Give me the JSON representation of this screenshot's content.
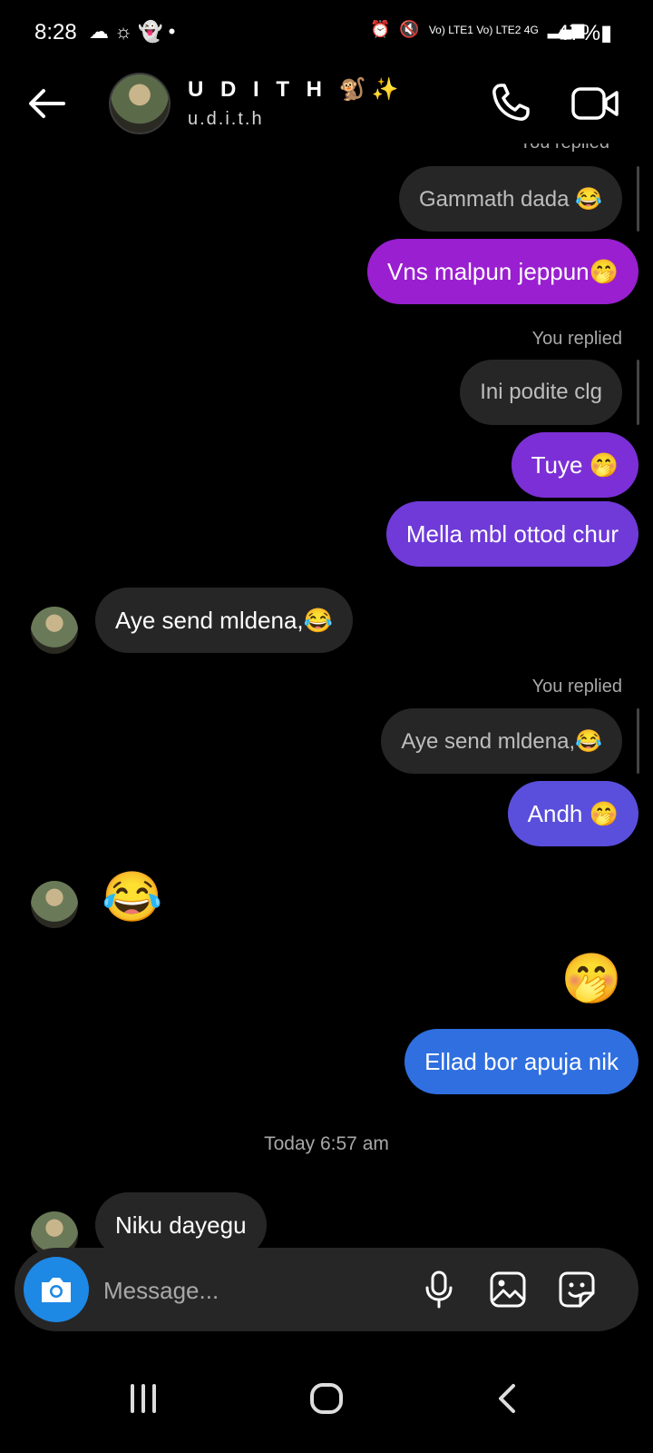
{
  "status_bar": {
    "time": "8:28",
    "left_icons": [
      "cloud-icon",
      "sun-icon",
      "snapchat-icon",
      "dot-icon"
    ],
    "network": "Vo) LTE1 Vo) LTE2 4G",
    "battery": "47%"
  },
  "header": {
    "name": "U D I T H 🐒✨",
    "username": "u.d.i.t.h"
  },
  "messages": {
    "reply1_label": "You replied",
    "reply1_quote": "Gammath dada 😂",
    "m1": "Vns malpun jeppun🤭",
    "reply2_label": "You replied",
    "reply2_quote": "Ini podite clg",
    "m2": "Tuye 🤭",
    "m3": "Mella mbl ottod chur",
    "in1": "Aye send mldena,😂",
    "reply3_label": "You replied",
    "reply3_quote": "Aye send mldena,😂",
    "m4": "Andh 🤭",
    "in2": "😂",
    "m5": "🤭",
    "m6": "Ellad bor apuja nik",
    "timestamp": "Today 6:57 am",
    "in3": "Niku dayegu"
  },
  "bubble_colors": {
    "m1": "#9a1fd0",
    "m2": "#7c2fd6",
    "m3": "#6f3ad8",
    "m4": "#5a4fdc",
    "m6": "#2f6fe0"
  },
  "composer": {
    "placeholder": "Message..."
  }
}
